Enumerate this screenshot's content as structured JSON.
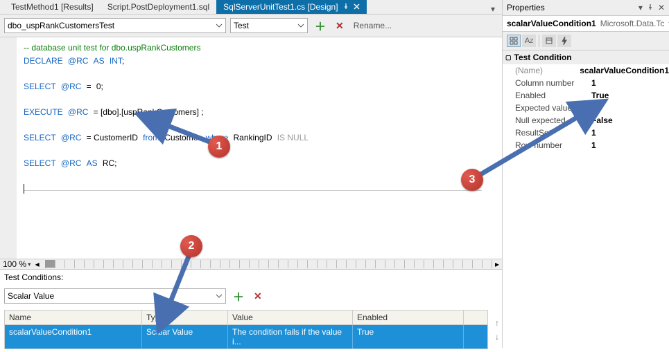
{
  "tabs": {
    "items": [
      {
        "label": "TestMethod1 [Results]"
      },
      {
        "label": "Script.PostDeployment1.sql"
      },
      {
        "label": "SqlServerUnitTest1.cs [Design]"
      }
    ],
    "active_index": 2
  },
  "toolbar": {
    "class_dropdown": "dbo_uspRankCustomersTest",
    "mode_dropdown": "Test",
    "rename_label": "Rename..."
  },
  "code": {
    "comment": "-- database unit test for dbo.uspRankCustomers",
    "line2_a": "DECLARE",
    "line2_b": "@RC",
    "line2_c": "AS",
    "line2_d": "INT",
    "line2_e": ";",
    "line3_a": "SELECT",
    "line3_b": "@RC",
    "line3_c": "=",
    "line3_d": "0;",
    "line4_a": "EXECUTE",
    "line4_b": "@RC",
    "line4_c": "= [dbo].[uspRankCustomers] ;",
    "line5_a": "SELECT",
    "line5_b": "@RC",
    "line5_c": "= CustomerID",
    "line5_d": "from",
    "line5_e": "Customer",
    "line5_f": "where",
    "line5_g": "RankingID",
    "line5_h": "IS NULL",
    "line6_a": "SELECT",
    "line6_b": "@RC",
    "line6_c": "AS",
    "line6_d": "RC;"
  },
  "zoom": {
    "label": "100 %"
  },
  "conditions": {
    "label": "Test Conditions:",
    "type_dropdown": "Scalar Value",
    "columns": {
      "name": "Name",
      "type": "Type",
      "value": "Value",
      "enabled": "Enabled"
    },
    "row": {
      "name": "scalarValueCondition1",
      "type": "Scalar Value",
      "value": "The condition fails if the value i...",
      "enabled": "True"
    }
  },
  "properties": {
    "title": "Properties",
    "object_name": "scalarValueCondition1",
    "object_type": "Microsoft.Data.Tc",
    "category": "Test Condition",
    "rows": [
      {
        "k": "(Name)",
        "v": "scalarValueCondition1",
        "gray": true
      },
      {
        "k": "Column number",
        "v": "1"
      },
      {
        "k": "Enabled",
        "v": "True"
      },
      {
        "k": "Expected value",
        "v": "0"
      },
      {
        "k": "Null expected",
        "v": "False"
      },
      {
        "k": "ResultSet",
        "v": "1"
      },
      {
        "k": "Row number",
        "v": "1"
      }
    ]
  },
  "bubbles": {
    "b1": "1",
    "b2": "2",
    "b3": "3"
  }
}
